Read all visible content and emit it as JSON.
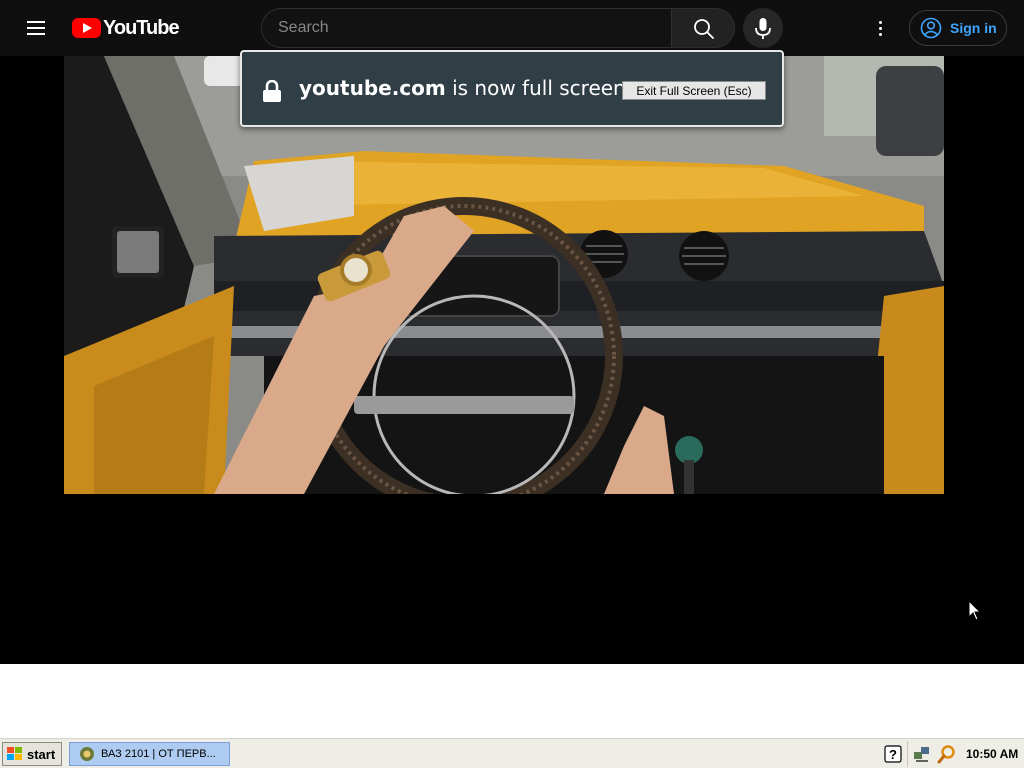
{
  "masthead": {
    "logo_text": "YouTube",
    "search_placeholder": "Search",
    "signin_label": "Sign in"
  },
  "fullscreen_notice": {
    "domain": "youtube.com",
    "message": " is now full screen",
    "exit_label": "Exit Full Screen (Esc)"
  },
  "taskbar": {
    "start_label": "start",
    "task_label": "ВАЗ 2101 | ОТ ПЕРВ...",
    "clock": "10:50 AM"
  },
  "colors": {
    "masthead_bg": "#0f0f0f",
    "brand_red": "#ff0000",
    "signin_blue": "#3ea6ff",
    "notice_bg": "#303e46"
  },
  "icons": [
    "menu-icon",
    "youtube-logo-icon",
    "search-icon",
    "microphone-icon",
    "more-vert-icon",
    "account-icon",
    "lock-icon",
    "cursor-arrow-icon",
    "windows-flag-icon",
    "app-icon",
    "help-icon",
    "network-icon",
    "search-tray-icon"
  ]
}
